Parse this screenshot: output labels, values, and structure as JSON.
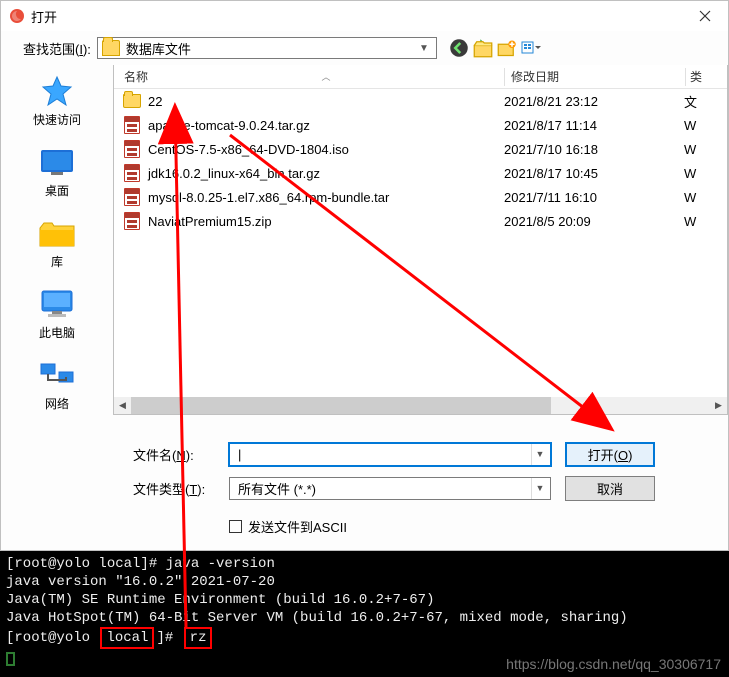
{
  "dialog": {
    "title": "打开",
    "close_label": "×",
    "lookin_label_pre": "查找范围(",
    "lookin_hotkey": "I",
    "lookin_label_post": "):",
    "lookin_value": "数据库文件",
    "columns": {
      "name": "名称",
      "date": "修改日期",
      "type": "类"
    },
    "files": [
      {
        "icon": "folder",
        "name": "22",
        "date": "2021/8/21 23:12",
        "type": "文"
      },
      {
        "icon": "archive",
        "name": "apache-tomcat-9.0.24.tar.gz",
        "date": "2021/8/17 11:14",
        "type": "W"
      },
      {
        "icon": "archive",
        "name": "CentOS-7.5-x86_64-DVD-1804.iso",
        "date": "2021/7/10 16:18",
        "type": "W"
      },
      {
        "icon": "archive",
        "name": "jdk16.0.2_linux-x64_bin.tar.gz",
        "date": "2021/8/17 10:45",
        "type": "W"
      },
      {
        "icon": "archive",
        "name": "mysql-8.0.25-1.el7.x86_64.rpm-bundle.tar",
        "date": "2021/7/11 16:10",
        "type": "W"
      },
      {
        "icon": "archive",
        "name": "NaviatPremium15.zip",
        "date": "2021/8/5 20:09",
        "type": "W"
      }
    ],
    "filename_label_pre": "文件名(",
    "filename_hotkey": "N",
    "filename_label_post": "):",
    "filename_value": "",
    "filetype_label_pre": "文件类型(",
    "filetype_hotkey": "T",
    "filetype_label_post": "):",
    "filetype_value": "所有文件 (*.*)",
    "open_btn": "打开(O)",
    "cancel_btn": "取消",
    "ascii_checkbox": "发送文件到ASCII"
  },
  "sidebar": [
    {
      "key": "quick",
      "label": "快速访问"
    },
    {
      "key": "desktop",
      "label": "桌面"
    },
    {
      "key": "library",
      "label": "库"
    },
    {
      "key": "pc",
      "label": "此电脑"
    },
    {
      "key": "network",
      "label": "网络"
    }
  ],
  "terminal": {
    "lines": [
      "[root@yolo local]# java -version",
      "java version \"16.0.2\" 2021-07-20",
      "Java(TM) SE Runtime Environment (build 16.0.2+7-67)",
      "Java HotSpot(TM) 64-Bit Server VM (build 16.0.2+7-67, mixed mode, sharing)"
    ],
    "prompt_user": "root@yolo",
    "prompt_box1": "local",
    "prompt_box2": "rz"
  },
  "watermark": "https://blog.csdn.net/qq_30306717"
}
